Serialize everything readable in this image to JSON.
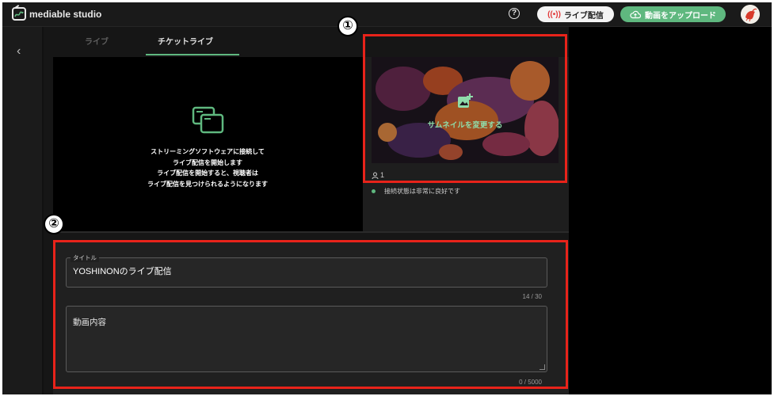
{
  "header": {
    "brand_main": "mediable",
    "brand_sub": " studio",
    "help_glyph": "?",
    "live_button": "ライブ配信",
    "upload_button": "動画をアップロード"
  },
  "tabs": [
    {
      "label": "ライブ",
      "active": false
    },
    {
      "label": "チケットライブ",
      "active": true
    }
  ],
  "player": {
    "message_lines": [
      "ストリーミングソフトウェアに接続して",
      "ライブ配信を開始します",
      "ライブ配信を開始すると、視聴者は",
      "ライブ配信を見つけられるようになります"
    ]
  },
  "thumbnail": {
    "change_label": "サムネイルを変更する",
    "viewer_count": "1"
  },
  "connection": {
    "status_text": "接続状態は非常に良好です",
    "status_color": "#5fb87f"
  },
  "form": {
    "title_legend": "タイトル",
    "title_value": "YOSHINONのライブ配信",
    "title_counter": "14 / 30",
    "description_placeholder": "動画内容",
    "description_counter": "0 / 5000"
  },
  "annotations": {
    "marker_1": "①",
    "marker_2": "②",
    "highlight_color": "#e8231a"
  },
  "colors": {
    "accent": "#5fb87f",
    "background": "#111111"
  }
}
